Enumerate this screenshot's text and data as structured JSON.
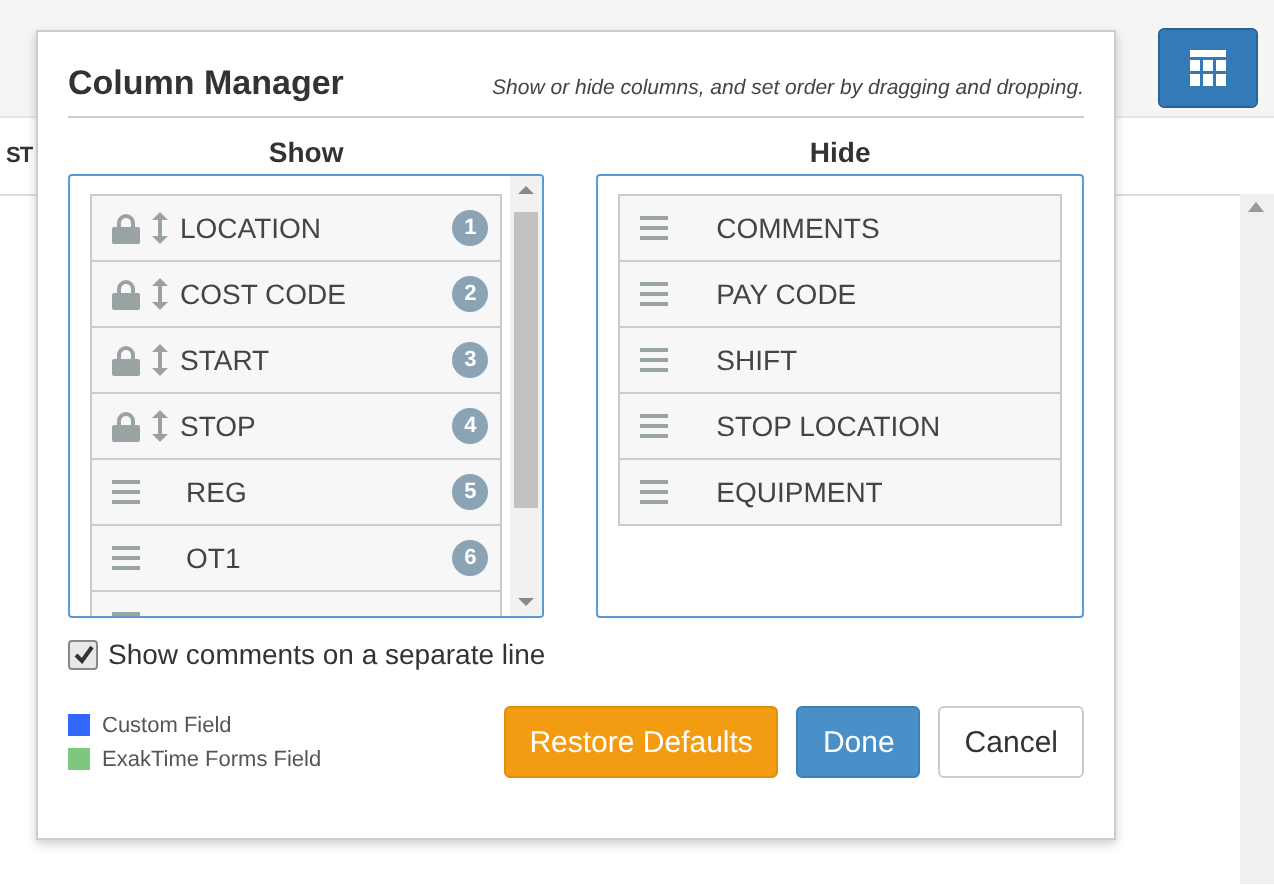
{
  "background": {
    "column_header": "ST"
  },
  "dialog": {
    "title": "Column Manager",
    "subtitle": "Show or hide columns, and set order by dragging and dropping.",
    "show": {
      "heading": "Show",
      "items": [
        {
          "label": "LOCATION",
          "kind": "locked",
          "number": "1"
        },
        {
          "label": "COST CODE",
          "kind": "locked",
          "number": "2"
        },
        {
          "label": "START",
          "kind": "locked",
          "number": "3"
        },
        {
          "label": "STOP",
          "kind": "locked",
          "number": "4"
        },
        {
          "label": "REG",
          "kind": "draggable",
          "number": "5"
        },
        {
          "label": "OT1",
          "kind": "draggable",
          "number": "6"
        },
        {
          "kind": "draggable"
        }
      ]
    },
    "hide": {
      "heading": "Hide",
      "items": [
        {
          "label": "COMMENTS",
          "kind": "draggable"
        },
        {
          "label": "PAY CODE",
          "kind": "draggable"
        },
        {
          "label": "SHIFT",
          "kind": "draggable"
        },
        {
          "label": "STOP LOCATION",
          "kind": "draggable"
        },
        {
          "label": "EQUIPMENT",
          "kind": "draggable"
        }
      ]
    },
    "checkbox": {
      "label": "Show comments on a separate line",
      "checked": true
    },
    "legend": [
      {
        "label": "Custom Field",
        "color": "#3366ff"
      },
      {
        "label": "ExakTime Forms Field",
        "color": "#7ec87e"
      }
    ],
    "buttons": [
      {
        "label": "Restore Defaults",
        "kind": "warning"
      },
      {
        "label": "Done",
        "kind": "primary"
      },
      {
        "label": "Cancel",
        "kind": "default"
      }
    ]
  }
}
